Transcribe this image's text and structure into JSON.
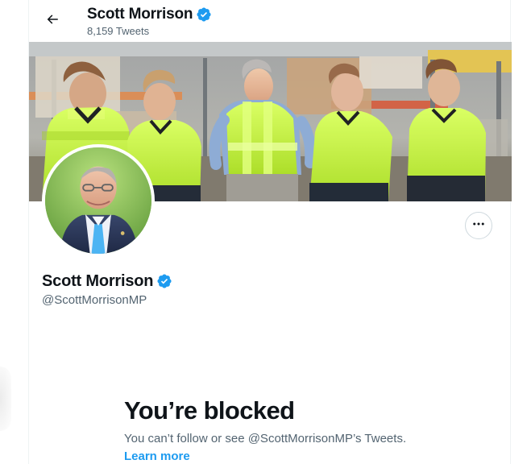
{
  "topbar": {
    "back_icon": "arrow-left-icon",
    "name": "Scott Morrison",
    "tweet_count": "8,159 Tweets"
  },
  "profile": {
    "name": "Scott Morrison",
    "handle": "@ScottMorrisonMP",
    "verified_icon": "verified-badge-icon",
    "more_icon": "more-horizontal-icon"
  },
  "blocked": {
    "title": "You’re blocked",
    "description": "You can’t follow or see @ScottMorrisonMP’s Tweets.",
    "learn_more": "Learn more"
  },
  "colors": {
    "accent": "#1d9bf0",
    "text_primary": "#0f1419",
    "text_secondary": "#536471",
    "border": "#cfd9de"
  }
}
